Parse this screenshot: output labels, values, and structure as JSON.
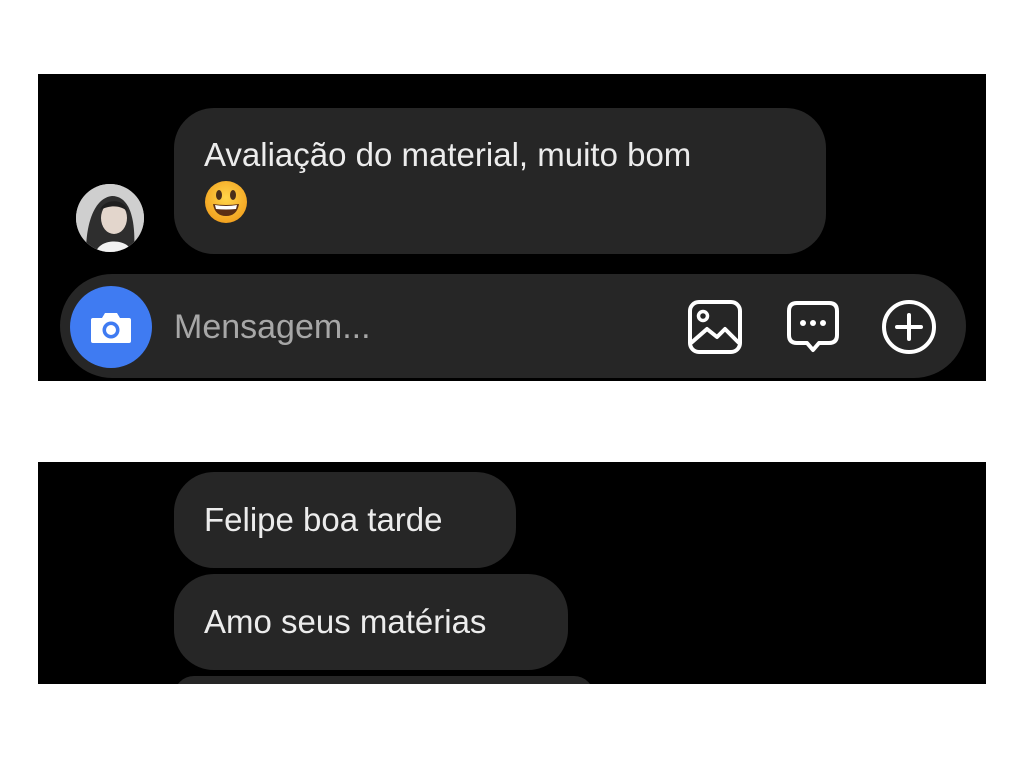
{
  "conversation_top": {
    "received_message": {
      "text": "Avaliação do material, muito bom",
      "emoji": "grinning-face-emoji"
    },
    "composer": {
      "placeholder": "Mensagem...",
      "camera_icon": "camera-icon",
      "gallery_icon": "image-icon",
      "sticker_icon": "chat-bubble-dots-icon",
      "more_icon": "plus-circle-icon",
      "camera_color": "#3f7bf2"
    }
  },
  "conversation_bottom": {
    "messages": [
      {
        "text": "Felipe boa tarde"
      },
      {
        "text": "Amo seus matérias"
      },
      {
        "text": ""
      }
    ]
  },
  "colors": {
    "background": "#000000",
    "bubble": "#262626",
    "text": "#ececec",
    "placeholder": "#a7a7a7"
  }
}
